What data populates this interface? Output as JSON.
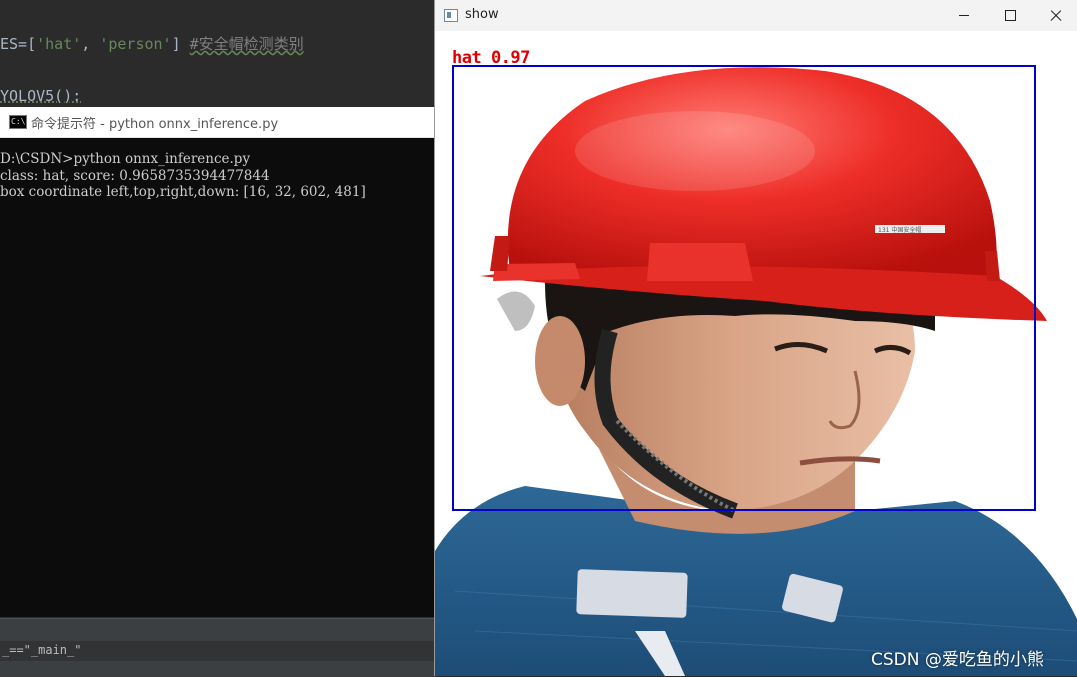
{
  "ide": {
    "code_line1": {
      "prefix": "ES=[",
      "str1": "'hat'",
      "sep": ", ",
      "str2": "'person'",
      "suffix": "] ",
      "comment": "#安全帽检测类别"
    },
    "code_line2": "YOLOV5():",
    "bottom_text": "_==\"_main_\""
  },
  "cmd": {
    "title": "命令提示符 - python  onnx_inference.py",
    "icon_text": "C:\\",
    "lines": [
      "D:\\CSDN>python onnx_inference.py",
      "class: hat, score: 0.9658735394477844",
      "box coordinate left,top,right,down: [16, 32, 602, 481]"
    ]
  },
  "show": {
    "title": "show",
    "detection": {
      "label": "hat 0.97",
      "box_color": "#0000cc",
      "label_color": "#e00000"
    },
    "helmet_tag": "131 中国安全帽",
    "watermark": "CSDN @爱吃鱼的小熊"
  }
}
